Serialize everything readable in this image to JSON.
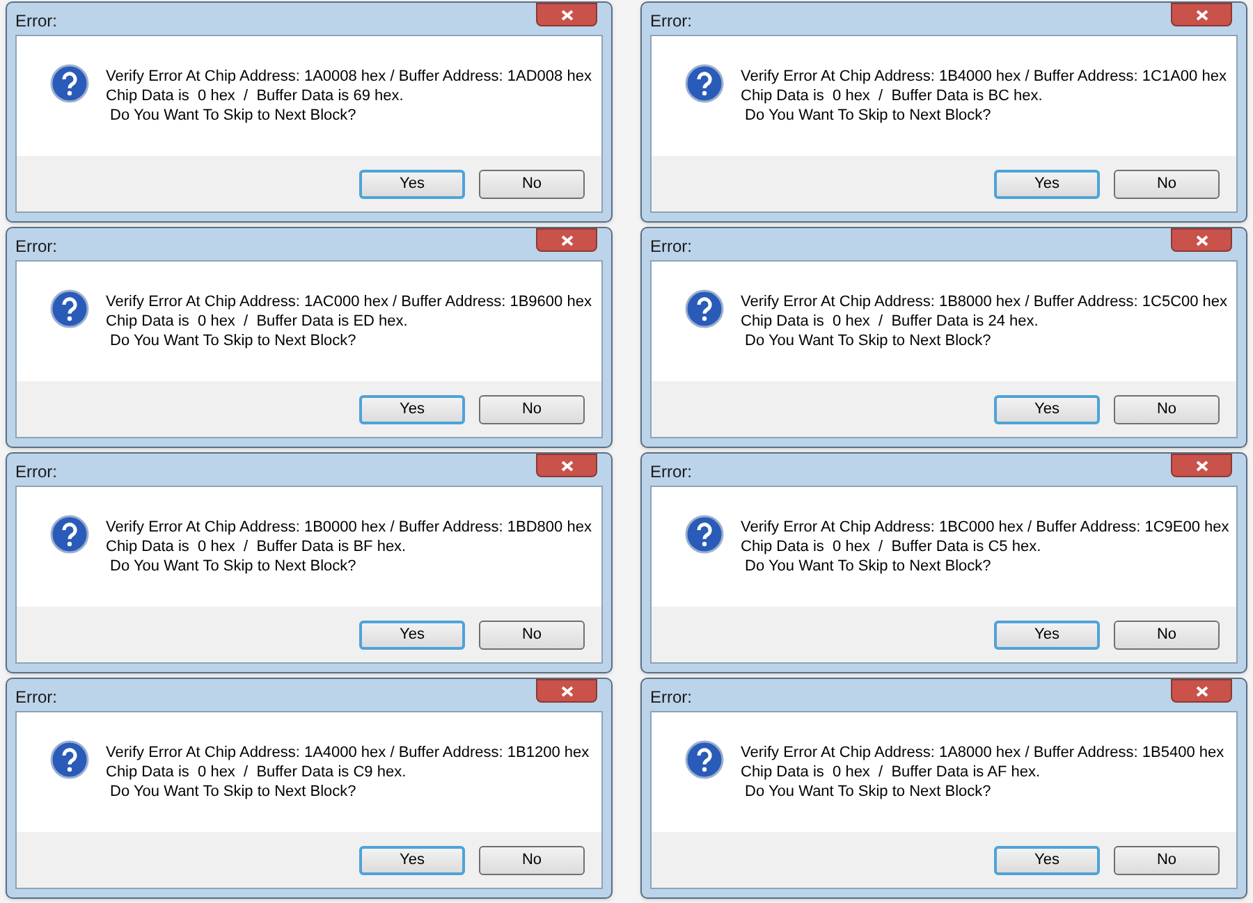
{
  "dialogs": [
    {
      "title": "Error:",
      "lines": [
        "Verify Error At Chip Address: 1A0008 hex / Buffer Address: 1AD008 hex",
        "Chip Data is  0 hex  /  Buffer Data is 69 hex.",
        " Do You Want To Skip to Next Block?"
      ],
      "buttons": [
        {
          "label": "Yes",
          "default": true
        },
        {
          "label": "No",
          "default": false
        }
      ]
    },
    {
      "title": "Error:",
      "lines": [
        "Verify Error At Chip Address: 1B4000 hex / Buffer Address: 1C1A00 hex",
        "Chip Data is  0 hex  /  Buffer Data is BC hex.",
        " Do You Want To Skip to Next Block?"
      ],
      "buttons": [
        {
          "label": "Yes",
          "default": true
        },
        {
          "label": "No",
          "default": false
        }
      ]
    },
    {
      "title": "Error:",
      "lines": [
        "Verify Error At Chip Address: 1AC000 hex / Buffer Address: 1B9600 hex",
        "Chip Data is  0 hex  /  Buffer Data is ED hex.",
        " Do You Want To Skip to Next Block?"
      ],
      "buttons": [
        {
          "label": "Yes",
          "default": true
        },
        {
          "label": "No",
          "default": false
        }
      ]
    },
    {
      "title": "Error:",
      "lines": [
        "Verify Error At Chip Address: 1B8000 hex / Buffer Address: 1C5C00 hex",
        "Chip Data is  0 hex  /  Buffer Data is 24 hex.",
        " Do You Want To Skip to Next Block?"
      ],
      "buttons": [
        {
          "label": "Yes",
          "default": true
        },
        {
          "label": "No",
          "default": false
        }
      ]
    },
    {
      "title": "Error:",
      "lines": [
        "Verify Error At Chip Address: 1B0000 hex / Buffer Address: 1BD800 hex",
        "Chip Data is  0 hex  /  Buffer Data is BF hex.",
        " Do You Want To Skip to Next Block?"
      ],
      "buttons": [
        {
          "label": "Yes",
          "default": true
        },
        {
          "label": "No",
          "default": false
        }
      ]
    },
    {
      "title": "Error:",
      "lines": [
        "Verify Error At Chip Address: 1BC000 hex / Buffer Address: 1C9E00 hex",
        "Chip Data is  0 hex  /  Buffer Data is C5 hex.",
        " Do You Want To Skip to Next Block?"
      ],
      "buttons": [
        {
          "label": "Yes",
          "default": true
        },
        {
          "label": "No",
          "default": false
        }
      ]
    },
    {
      "title": "Error:",
      "lines": [
        "Verify Error At Chip Address: 1A4000 hex / Buffer Address: 1B1200 hex",
        "Chip Data is  0 hex  /  Buffer Data is C9 hex.",
        " Do You Want To Skip to Next Block?"
      ],
      "buttons": [
        {
          "label": "Yes",
          "default": true
        },
        {
          "label": "No",
          "default": false
        }
      ]
    },
    {
      "title": "Error:",
      "lines": [
        "Verify Error At Chip Address: 1A8000 hex / Buffer Address: 1B5400 hex",
        "Chip Data is  0 hex  /  Buffer Data is AF hex.",
        " Do You Want To Skip to Next Block?"
      ],
      "buttons": [
        {
          "label": "Yes",
          "default": true
        },
        {
          "label": "No",
          "default": false
        }
      ]
    }
  ]
}
